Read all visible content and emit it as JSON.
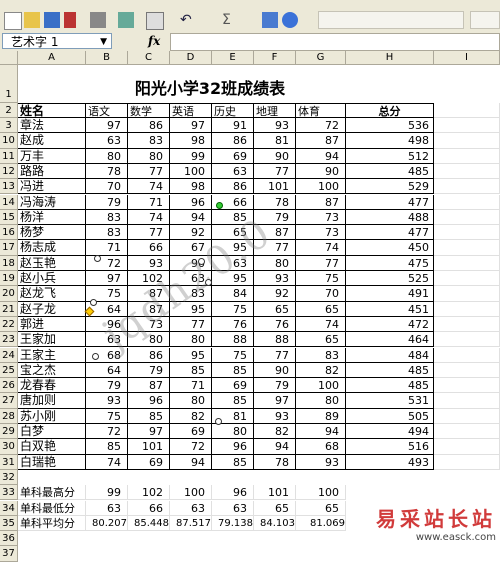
{
  "formula_bar": {
    "name_box": "艺术字 1",
    "fx": "fx"
  },
  "columns": [
    "A",
    "B",
    "C",
    "D",
    "E",
    "F",
    "G",
    "H",
    "I"
  ],
  "title": "阳光小学32班成绩表",
  "headers": {
    "name": "姓名",
    "chinese": "语文",
    "math": "数学",
    "english": "英语",
    "history": "历史",
    "geography": "地理",
    "pe": "体育",
    "total": "总分"
  },
  "students": [
    {
      "row": "3",
      "name": "章法",
      "v": [
        "97",
        "86",
        "97",
        "91",
        "93",
        "72",
        "536"
      ]
    },
    {
      "row": "10",
      "name": "赵成",
      "v": [
        "63",
        "83",
        "98",
        "86",
        "81",
        "87",
        "498"
      ]
    },
    {
      "row": "11",
      "name": "万丰",
      "v": [
        "80",
        "80",
        "99",
        "69",
        "90",
        "94",
        "512"
      ]
    },
    {
      "row": "12",
      "name": "路路",
      "v": [
        "78",
        "77",
        "100",
        "63",
        "77",
        "90",
        "485"
      ]
    },
    {
      "row": "13",
      "name": "冯进",
      "v": [
        "70",
        "74",
        "98",
        "86",
        "101",
        "100",
        "529"
      ]
    },
    {
      "row": "14",
      "name": "冯海涛",
      "v": [
        "79",
        "71",
        "96",
        "66",
        "78",
        "87",
        "477"
      ]
    },
    {
      "row": "15",
      "name": "杨洋",
      "v": [
        "83",
        "74",
        "94",
        "85",
        "79",
        "73",
        "488"
      ]
    },
    {
      "row": "16",
      "name": "杨梦",
      "v": [
        "83",
        "77",
        "92",
        "65",
        "87",
        "73",
        "477"
      ]
    },
    {
      "row": "17",
      "name": "杨志成",
      "v": [
        "71",
        "66",
        "67",
        "95",
        "77",
        "74",
        "450"
      ]
    },
    {
      "row": "18",
      "name": "赵玉艳",
      "v": [
        "72",
        "93",
        "90",
        "63",
        "80",
        "77",
        "475"
      ]
    },
    {
      "row": "19",
      "name": "赵小兵",
      "v": [
        "97",
        "102",
        "63",
        "95",
        "93",
        "75",
        "525"
      ]
    },
    {
      "row": "20",
      "name": "赵龙飞",
      "v": [
        "75",
        "87",
        "83",
        "84",
        "92",
        "70",
        "491"
      ]
    },
    {
      "row": "21",
      "name": "赵子龙",
      "v": [
        "64",
        "87",
        "95",
        "75",
        "65",
        "65",
        "451"
      ]
    },
    {
      "row": "22",
      "name": "郭进",
      "v": [
        "96",
        "73",
        "77",
        "76",
        "76",
        "74",
        "472"
      ]
    },
    {
      "row": "23",
      "name": "王家加",
      "v": [
        "63",
        "80",
        "80",
        "88",
        "88",
        "65",
        "464"
      ]
    },
    {
      "row": "24",
      "name": "王家主",
      "v": [
        "68",
        "86",
        "95",
        "75",
        "77",
        "83",
        "484"
      ]
    },
    {
      "row": "25",
      "name": "宝之杰",
      "v": [
        "64",
        "79",
        "85",
        "85",
        "90",
        "82",
        "485"
      ]
    },
    {
      "row": "26",
      "name": "龙春春",
      "v": [
        "79",
        "87",
        "71",
        "69",
        "79",
        "100",
        "485"
      ]
    },
    {
      "row": "27",
      "name": "唐加则",
      "v": [
        "93",
        "96",
        "80",
        "85",
        "97",
        "80",
        "531"
      ]
    },
    {
      "row": "28",
      "name": "苏小刚",
      "v": [
        "75",
        "85",
        "82",
        "81",
        "93",
        "89",
        "505"
      ]
    },
    {
      "row": "29",
      "name": "白梦",
      "v": [
        "72",
        "97",
        "69",
        "80",
        "82",
        "94",
        "494"
      ]
    },
    {
      "row": "30",
      "name": "白双艳",
      "v": [
        "85",
        "101",
        "72",
        "96",
        "94",
        "68",
        "516"
      ]
    },
    {
      "row": "31",
      "name": "白瑞艳",
      "v": [
        "74",
        "69",
        "94",
        "85",
        "78",
        "93",
        "493"
      ]
    }
  ],
  "summary": [
    {
      "row": "33",
      "label": "单科最高分",
      "v": [
        "99",
        "102",
        "100",
        "96",
        "101",
        "100"
      ]
    },
    {
      "row": "34",
      "label": "单科最低分",
      "v": [
        "63",
        "66",
        "63",
        "63",
        "65",
        "65"
      ]
    },
    {
      "row": "35",
      "label": "单科平均分",
      "v": [
        "80.207",
        "85.448",
        "87.517",
        "79.138",
        "84.103",
        "81.069"
      ]
    }
  ],
  "row_labels": {
    "r1": "1",
    "r2": "2",
    "r32": "32",
    "r36": "36",
    "r37": "37"
  },
  "watermark": "jqdh20.0",
  "site": {
    "name": "易采站长站",
    "url": "www.easck.com"
  }
}
